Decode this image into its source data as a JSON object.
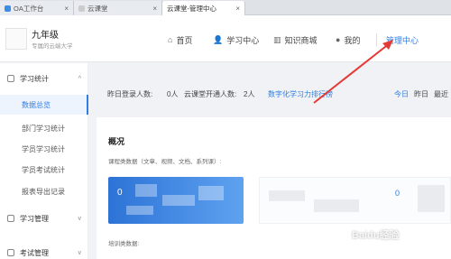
{
  "browser": {
    "tabs": [
      {
        "label": "OA工作台",
        "favicon_color": "#3a8ee6"
      },
      {
        "label": "云课堂",
        "favicon_color": "#cccccc"
      },
      {
        "label": "云课堂-管理中心",
        "favicon_color": "#ffffff"
      }
    ],
    "close_glyph": "×"
  },
  "header": {
    "org_name": "九年级",
    "org_subtitle": "专属的云端大学",
    "nav": [
      {
        "label": "首页",
        "icon": "home-icon",
        "glyph": "⌂"
      },
      {
        "label": "学习中心",
        "icon": "user-icon",
        "glyph": "👤"
      },
      {
        "label": "知识商城",
        "icon": "books-icon",
        "glyph": "▥"
      },
      {
        "label": "我的",
        "icon": "person-icon",
        "glyph": "●"
      },
      {
        "label": "管理中心",
        "icon": "",
        "glyph": ""
      }
    ],
    "accent": "#2f7ee3"
  },
  "sidebar": {
    "groups": [
      {
        "label": "学习统计",
        "arrow": "^",
        "items": [
          "数据总览",
          "部门学习统计",
          "学员学习统计",
          "学员考试统计",
          "报表导出记录"
        ]
      },
      {
        "label": "学习管理",
        "arrow": "v"
      },
      {
        "label": "考试管理",
        "arrow": "v"
      }
    ]
  },
  "main": {
    "stats": {
      "yesterday_logins_label": "昨日登录人数:",
      "yesterday_logins_value": "0人",
      "cloud_users_label": "云课堂开通人数:",
      "cloud_users_value": "2人",
      "leaderboard_link": "数字化学习力排行榜",
      "range_today": "今日",
      "range_yesterday": "昨日",
      "range_recent": "最近"
    },
    "overview": {
      "title": "概况",
      "course_data_label": "课程类数据（文章、视频、文档、系列课）:",
      "course_tile_value": "0",
      "second_tile_value": "0",
      "training_data_label": "培训类数据:"
    }
  },
  "watermark": "Baidu经验"
}
